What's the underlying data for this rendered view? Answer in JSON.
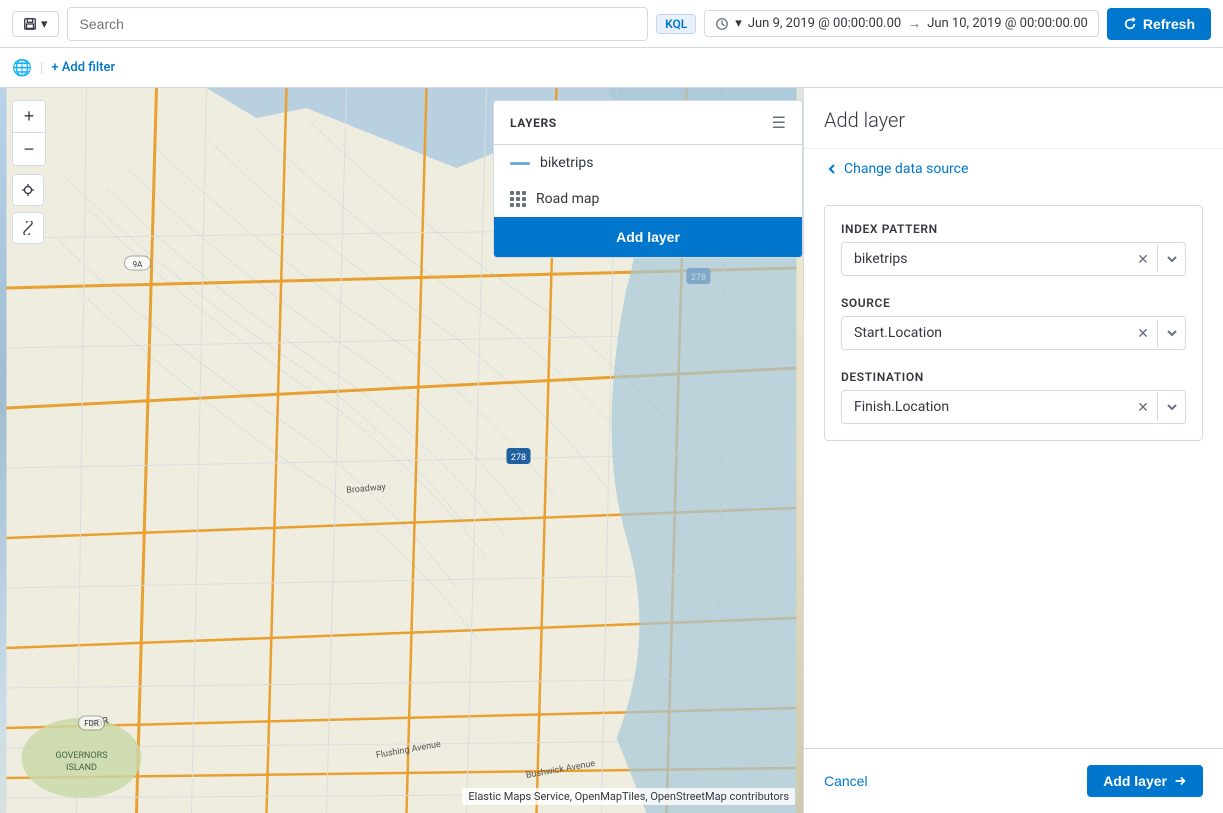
{
  "topbar": {
    "save_label": "Save",
    "search_placeholder": "Search",
    "kql_label": "KQL",
    "time_from": "Jun 9, 2019 @ 00:00:00.00",
    "time_to": "Jun 10, 2019 @ 00:00:00.00",
    "refresh_label": "Refresh"
  },
  "filterbar": {
    "add_filter_label": "+ Add filter"
  },
  "layers_panel": {
    "title": "LAYERS",
    "items": [
      {
        "name": "biketrips",
        "type": "line"
      },
      {
        "name": "Road map",
        "type": "grid"
      }
    ],
    "add_button": "Add layer"
  },
  "map": {
    "attribution": "Elastic Maps Service, OpenMapTiles, OpenStreetMap contributors"
  },
  "right_panel": {
    "title": "Add layer",
    "change_source_label": "Change data source",
    "form": {
      "index_pattern_label": "Index pattern",
      "index_pattern_value": "biketrips",
      "source_label": "Source",
      "source_value": "Start.Location",
      "destination_label": "Destination",
      "destination_value": "Finish.Location"
    },
    "cancel_label": "Cancel",
    "add_layer_label": "Add layer"
  }
}
